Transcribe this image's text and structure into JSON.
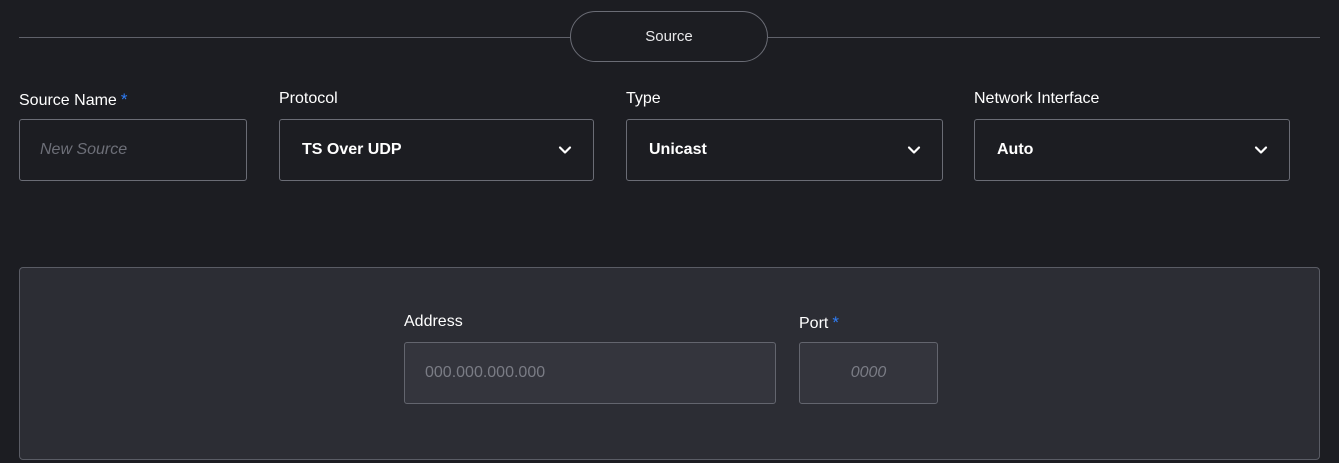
{
  "section": {
    "title": "Source"
  },
  "fields": {
    "source_name": {
      "label": "Source Name",
      "required_marker": "*",
      "placeholder": "New Source",
      "value": ""
    },
    "protocol": {
      "label": "Protocol",
      "value": "TS Over UDP",
      "icon": "chevron-down-icon"
    },
    "type": {
      "label": "Type",
      "value": "Unicast",
      "icon": "chevron-down-icon"
    },
    "network_interface": {
      "label": "Network Interface",
      "value": "Auto",
      "icon": "chevron-down-icon"
    }
  },
  "panel": {
    "address": {
      "label": "Address",
      "placeholder": "000.000.000.000",
      "value": ""
    },
    "port": {
      "label": "Port",
      "required_marker": "*",
      "placeholder": "0000",
      "value": ""
    }
  },
  "colors": {
    "background": "#1c1d22",
    "panel_background": "#2c2d34",
    "border": "#6a6c75",
    "required_accent": "#2f7df6",
    "placeholder": "#6d6f78"
  }
}
